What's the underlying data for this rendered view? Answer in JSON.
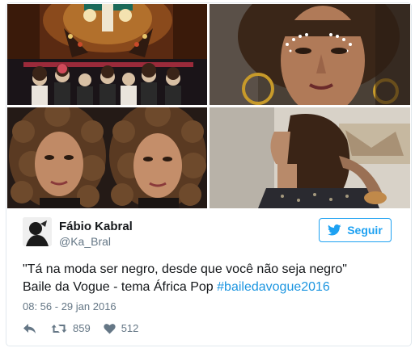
{
  "tweet": {
    "author_name": "Fábio Kabral",
    "author_handle": "@Ka_Bral",
    "follow_label": "Seguir",
    "text_line_1": "\"Tá na moda ser negro, desde que você não seja negro\"",
    "text_line_2_prefix": "Baile da Vogue - tema África Pop ",
    "hashtag": "#bailedavogue2016",
    "timestamp": "08: 56 - 29 jan 2016",
    "retweet_count": "859",
    "like_count": "512"
  },
  "icons": {
    "follow": "twitter-bird-icon",
    "reply": "reply-arrow-icon",
    "retweet": "retweet-icon",
    "like": "heart-icon"
  },
  "colors": {
    "accent": "#1da1f2",
    "hashtag": "#1b95e0",
    "muted": "#657786",
    "text": "#14171a",
    "border": "#e1e8ed"
  }
}
